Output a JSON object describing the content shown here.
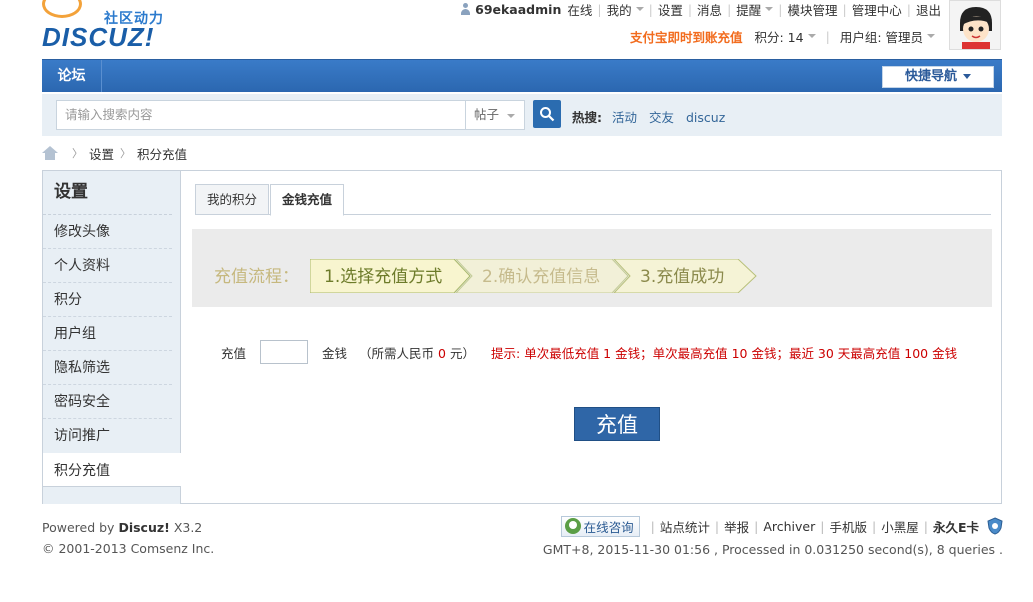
{
  "brand": {
    "logo_sub": "社区动力",
    "logo_main": "DISCUZ!"
  },
  "topbar": {
    "username": "69ekaadmin",
    "status": "在线",
    "links": [
      "我的",
      "设置",
      "消息",
      "提醒",
      "模块管理",
      "管理中心",
      "退出"
    ],
    "alipay": "支付宝即时到账充值",
    "credits_label": "积分: 14",
    "usergroup_label": "用户组: 管理员"
  },
  "nav": {
    "forum": "论坛",
    "quicknav": "快捷导航"
  },
  "search": {
    "placeholder": "请输入搜索内容",
    "type": "帖子",
    "hot_label": "热搜:",
    "hot_terms": [
      "活动",
      "交友",
      "discuz"
    ]
  },
  "breadcrumb": {
    "items": [
      "设置",
      "积分充值"
    ]
  },
  "sidebar": {
    "title": "设置",
    "items": [
      "修改头像",
      "个人资料",
      "积分",
      "用户组",
      "隐私筛选",
      "密码安全",
      "访问推广",
      "积分充值"
    ],
    "active_index": 7
  },
  "tabs": {
    "items": [
      "我的积分",
      "金钱充值"
    ],
    "active_index": 1
  },
  "flow": {
    "label": "充值流程：",
    "steps": [
      "1.选择充值方式",
      "2.确认充值信息",
      "3.充值成功"
    ]
  },
  "recharge": {
    "label": "充值",
    "amount_value": "",
    "unit": "金钱",
    "rmb_prefix": "（所需人民币",
    "rmb_value": "0",
    "rmb_suffix": "元）",
    "tip": "提示: 单次最低充值 1 金钱；单次最高充值 10 金钱；最近 30 天最高充值 100 金钱",
    "submit": "充值"
  },
  "footer": {
    "powered_prefix": "Powered by",
    "product": "Discuz!",
    "version": "X3.2",
    "copyright": "© 2001-2013 Comsenz Inc.",
    "consult": "在线咨询",
    "links": [
      "站点统计",
      "举报",
      "Archiver",
      "手机版",
      "小黑屋"
    ],
    "yjcard": "永久E卡",
    "time_info": "GMT+8, 2015-11-30 01:56 , Processed in 0.031250 second(s), 8 queries ."
  }
}
